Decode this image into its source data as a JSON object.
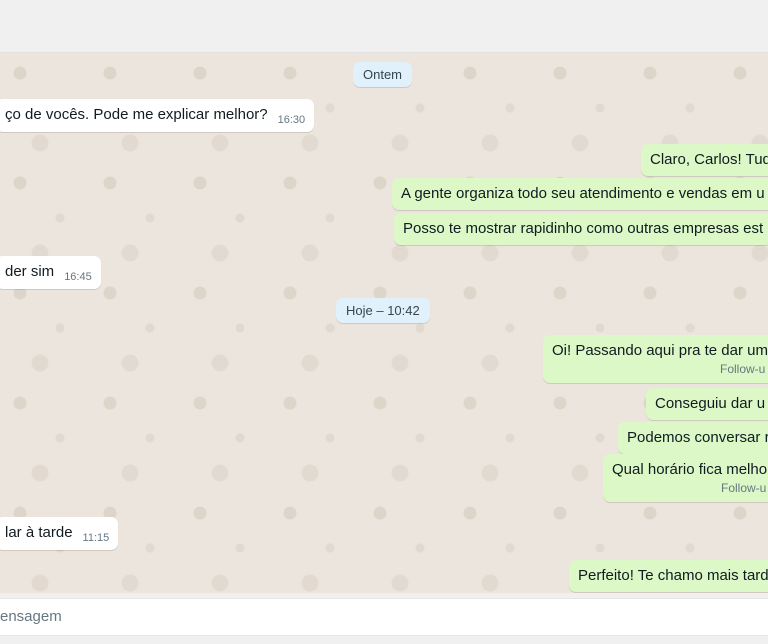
{
  "chat": {
    "day_labels": [
      "Ontem",
      "Hoje – 10:42"
    ],
    "messages": [
      {
        "text": "ço de vocês. Pode me explicar melhor?",
        "time": "16:30"
      },
      {
        "text": "Claro, Carlos! Tud"
      },
      {
        "text": "A gente organiza todo seu atendimento e vendas em u"
      },
      {
        "text": "Posso te mostrar rapidinho como outras empresas est"
      },
      {
        "text": "der sim",
        "time": "16:45"
      },
      {
        "text": "Oi! Passando aqui pra te dar um",
        "sub": "Follow-u"
      },
      {
        "text": "Conseguiu dar u"
      },
      {
        "text": "Podemos conversar r"
      },
      {
        "text": "Qual horário fica melho",
        "sub": "Follow-u"
      },
      {
        "text": "lar à tarde",
        "time": "11:15"
      },
      {
        "text": "Perfeito! Te chamo mais tard"
      }
    ]
  },
  "composer": {
    "placeholder": "ensagem"
  }
}
